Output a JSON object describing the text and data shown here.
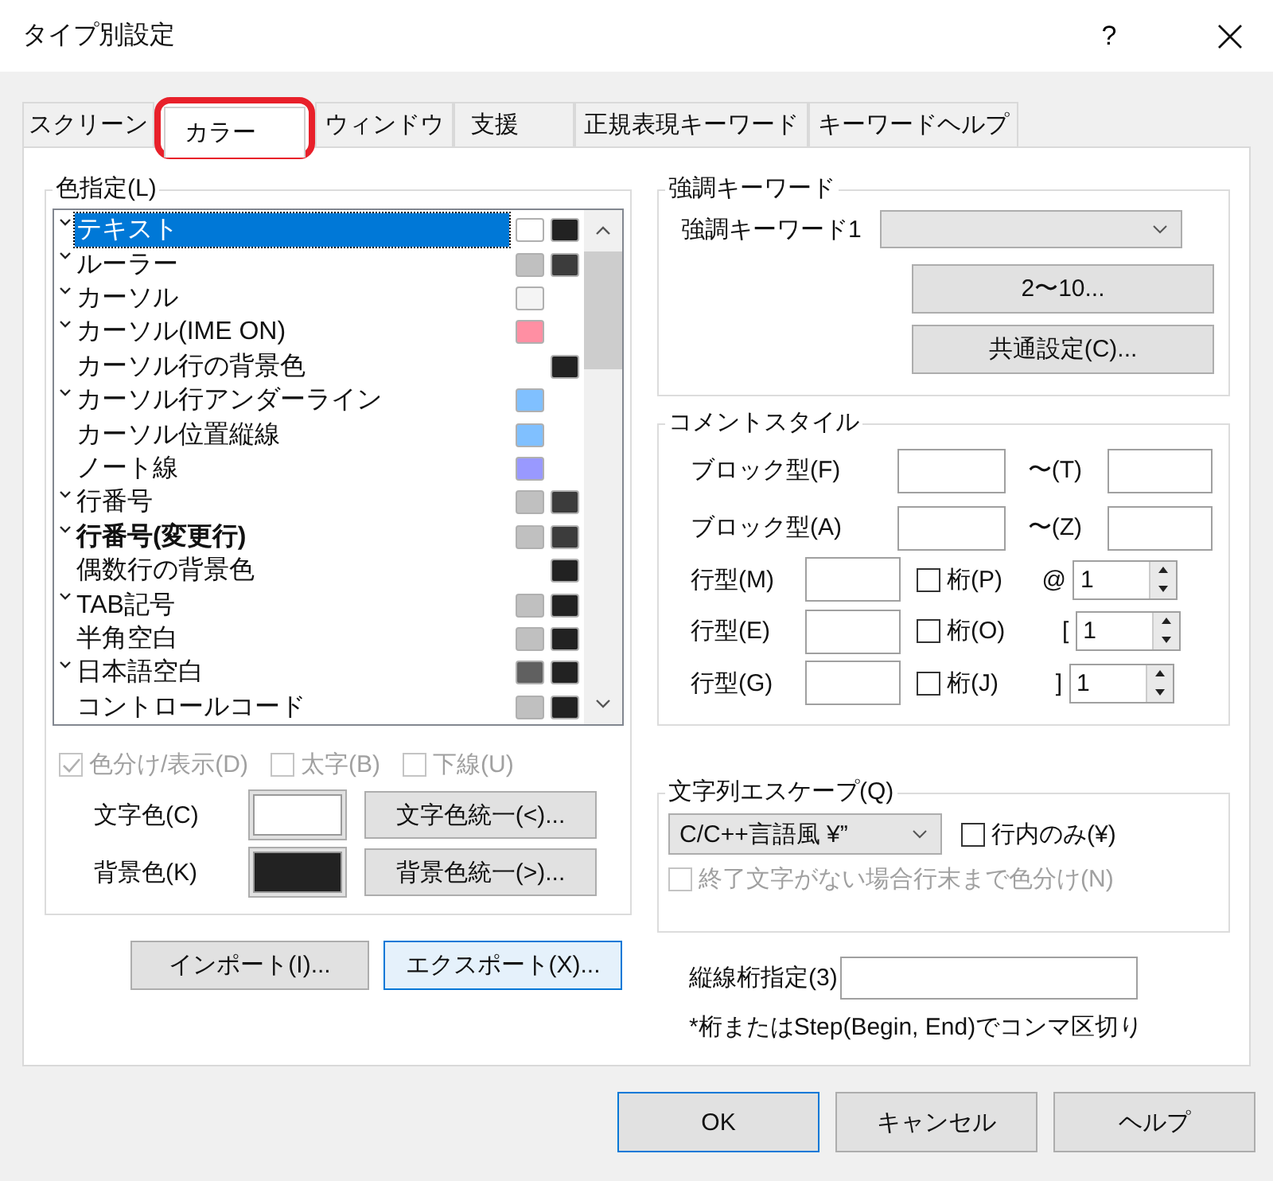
{
  "window": {
    "title": "タイプ別設定",
    "help": "?"
  },
  "tabs": [
    {
      "label": "スクリーン",
      "selected": false,
      "circled": false
    },
    {
      "label": "カラー",
      "selected": true,
      "circled": true
    },
    {
      "label": "ウィンドウ",
      "selected": false,
      "circled": false
    },
    {
      "label": "支援",
      "selected": false,
      "circled": false
    },
    {
      "label": "正規表現キーワード",
      "selected": false,
      "circled": false
    },
    {
      "label": "キーワードヘルプ",
      "selected": false,
      "circled": false
    }
  ],
  "color_group": {
    "title": "色指定(L)",
    "items": [
      {
        "label": "テキスト",
        "marked": true,
        "bold": false,
        "selected": true,
        "text_swatch": {
          "color": "#ffffff"
        },
        "back_swatch": {
          "color": "#222222"
        }
      },
      {
        "label": "ルーラー",
        "marked": true,
        "bold": false,
        "selected": false,
        "text_swatch": {
          "color": "#c0c0c0"
        },
        "back_swatch": {
          "color": "#3c3c3c"
        }
      },
      {
        "label": "カーソル",
        "marked": true,
        "bold": false,
        "selected": false,
        "text_swatch": {
          "color": "#f4f4f4"
        }
      },
      {
        "label": "カーソル(IME ON)",
        "marked": true,
        "bold": false,
        "selected": false,
        "text_swatch": {
          "color": "#ff8fa3"
        }
      },
      {
        "label": "カーソル行の背景色",
        "marked": false,
        "bold": false,
        "selected": false,
        "back_swatch": {
          "color": "#222222"
        }
      },
      {
        "label": "カーソル行アンダーライン",
        "marked": true,
        "bold": false,
        "selected": false,
        "text_swatch": {
          "color": "#80c0ff"
        }
      },
      {
        "label": "カーソル位置縦線",
        "marked": false,
        "bold": false,
        "selected": false,
        "text_swatch": {
          "color": "#80c0ff"
        }
      },
      {
        "label": "ノート線",
        "marked": false,
        "bold": false,
        "selected": false,
        "text_swatch": {
          "color": "#9999ff"
        }
      },
      {
        "label": "行番号",
        "marked": true,
        "bold": false,
        "selected": false,
        "text_swatch": {
          "color": "#c0c0c0"
        },
        "back_swatch": {
          "color": "#3c3c3c"
        }
      },
      {
        "label": "行番号(変更行)",
        "marked": true,
        "bold": true,
        "selected": false,
        "text_swatch": {
          "color": "#c0c0c0"
        },
        "back_swatch": {
          "color": "#3c3c3c"
        }
      },
      {
        "label": "偶数行の背景色",
        "marked": false,
        "bold": false,
        "selected": false,
        "back_swatch": {
          "color": "#222222"
        }
      },
      {
        "label": "TAB記号",
        "marked": true,
        "bold": false,
        "selected": false,
        "text_swatch": {
          "color": "#c0c0c0"
        },
        "back_swatch": {
          "color": "#222222"
        }
      },
      {
        "label": "半角空白",
        "marked": false,
        "bold": false,
        "selected": false,
        "text_swatch": {
          "color": "#c0c0c0"
        },
        "back_swatch": {
          "color": "#222222"
        }
      },
      {
        "label": "日本語空白",
        "marked": true,
        "bold": false,
        "selected": false,
        "text_swatch": {
          "color": "#606060"
        },
        "back_swatch": {
          "color": "#222222"
        }
      },
      {
        "label": "コントロールコード",
        "marked": false,
        "bold": false,
        "selected": false,
        "text_swatch": {
          "color": "#c0c0c0"
        },
        "back_swatch": {
          "color": "#222222"
        }
      }
    ],
    "options": [
      {
        "label": "色分け/表示(D)",
        "checked": true,
        "disabled": true
      },
      {
        "label": "太字(B)",
        "checked": false,
        "disabled": true
      },
      {
        "label": "下線(U)",
        "checked": false,
        "disabled": true
      }
    ],
    "color_rows": [
      {
        "label": "文字色(C)",
        "color": "#ffffff",
        "button": "文字色統一(<)..."
      },
      {
        "label": "背景色(K)",
        "color": "#222222",
        "button": "背景色統一(>)..."
      }
    ]
  },
  "import_button": "インポート(I)...",
  "export_button": "エクスポート(X)...",
  "keyword_group": {
    "title": "強調キーワード",
    "label": "強調キーワード1",
    "buttons": [
      "2〜10...",
      "共通設定(C)..."
    ]
  },
  "comment_group": {
    "title": "コメントスタイル",
    "rows": [
      {
        "kind": "block",
        "label": "ブロック型(F)",
        "end_label": "〜(T)"
      },
      {
        "kind": "block",
        "label": "ブロック型(A)",
        "end_label": "〜(Z)"
      },
      {
        "kind": "line",
        "label": "行型(M)",
        "check_label": "桁(P)",
        "checked": false,
        "prefix": "@",
        "value": "1"
      },
      {
        "kind": "line",
        "label": "行型(E)",
        "check_label": "桁(O)",
        "checked": false,
        "prefix": "[",
        "value": "1"
      },
      {
        "kind": "line",
        "label": "行型(G)",
        "check_label": "桁(J)",
        "checked": false,
        "prefix": "]",
        "value": "1"
      }
    ]
  },
  "escape_group": {
    "title": "文字列エスケープ(Q)",
    "value": "C/C++言語風 ¥”",
    "options": [
      {
        "label": "行内のみ(¥)",
        "checked": false,
        "disabled": false
      },
      {
        "label": "終了文字がない場合行末まで色分け(N)",
        "checked": false,
        "disabled": true
      }
    ]
  },
  "vline": {
    "label": "縦線桁指定(3)",
    "note": "*桁またはStep(Begin, End)でコンマ区切り"
  },
  "footer_buttons": [
    {
      "label": "OK",
      "default": true
    },
    {
      "label": "キャンセル",
      "default": false
    },
    {
      "label": "ヘルプ",
      "default": false
    }
  ]
}
